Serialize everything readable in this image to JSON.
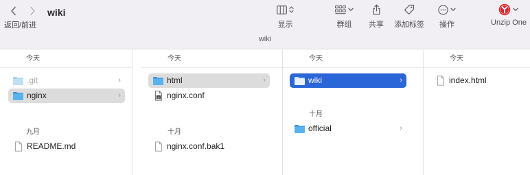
{
  "toolbar": {
    "title": "wiki",
    "nav_label": "返回/前进",
    "path_label": "wiki",
    "view_label": "显示",
    "group_label": "群组",
    "share_label": "共享",
    "tag_label": "添加标签",
    "action_label": "操作",
    "unzip_label": "Unzip One",
    "accent": "#d9262e"
  },
  "columns": [
    {
      "header": "今天",
      "group2": "九月",
      "items": [
        {
          "name": ".git",
          "icon": "folder-icon",
          "state": "dim"
        },
        {
          "name": "nginx",
          "icon": "folder-icon",
          "state": "selected-inactive"
        },
        {
          "name": "README.md",
          "icon": "document-icon"
        }
      ]
    },
    {
      "header": "今天",
      "group2": "十月",
      "items": [
        {
          "name": "html",
          "icon": "folder-icon",
          "state": "selected-inactive"
        },
        {
          "name": "nginx.conf",
          "icon": "document-icon"
        },
        {
          "name": "nginx.conf.bak1",
          "icon": "document-icon"
        }
      ]
    },
    {
      "header": "今天",
      "group2": "十月",
      "items": [
        {
          "name": "wiki",
          "icon": "folder-icon",
          "state": "selected"
        },
        {
          "name": "official",
          "icon": "folder-icon"
        }
      ]
    },
    {
      "header": "今天",
      "items": [
        {
          "name": "index.html",
          "icon": "document-icon"
        }
      ]
    }
  ],
  "colors": {
    "selection_blue": "#2b66d9",
    "folder_blue": "#5ab2ec",
    "toolbar_bg": "#f2eff4"
  }
}
